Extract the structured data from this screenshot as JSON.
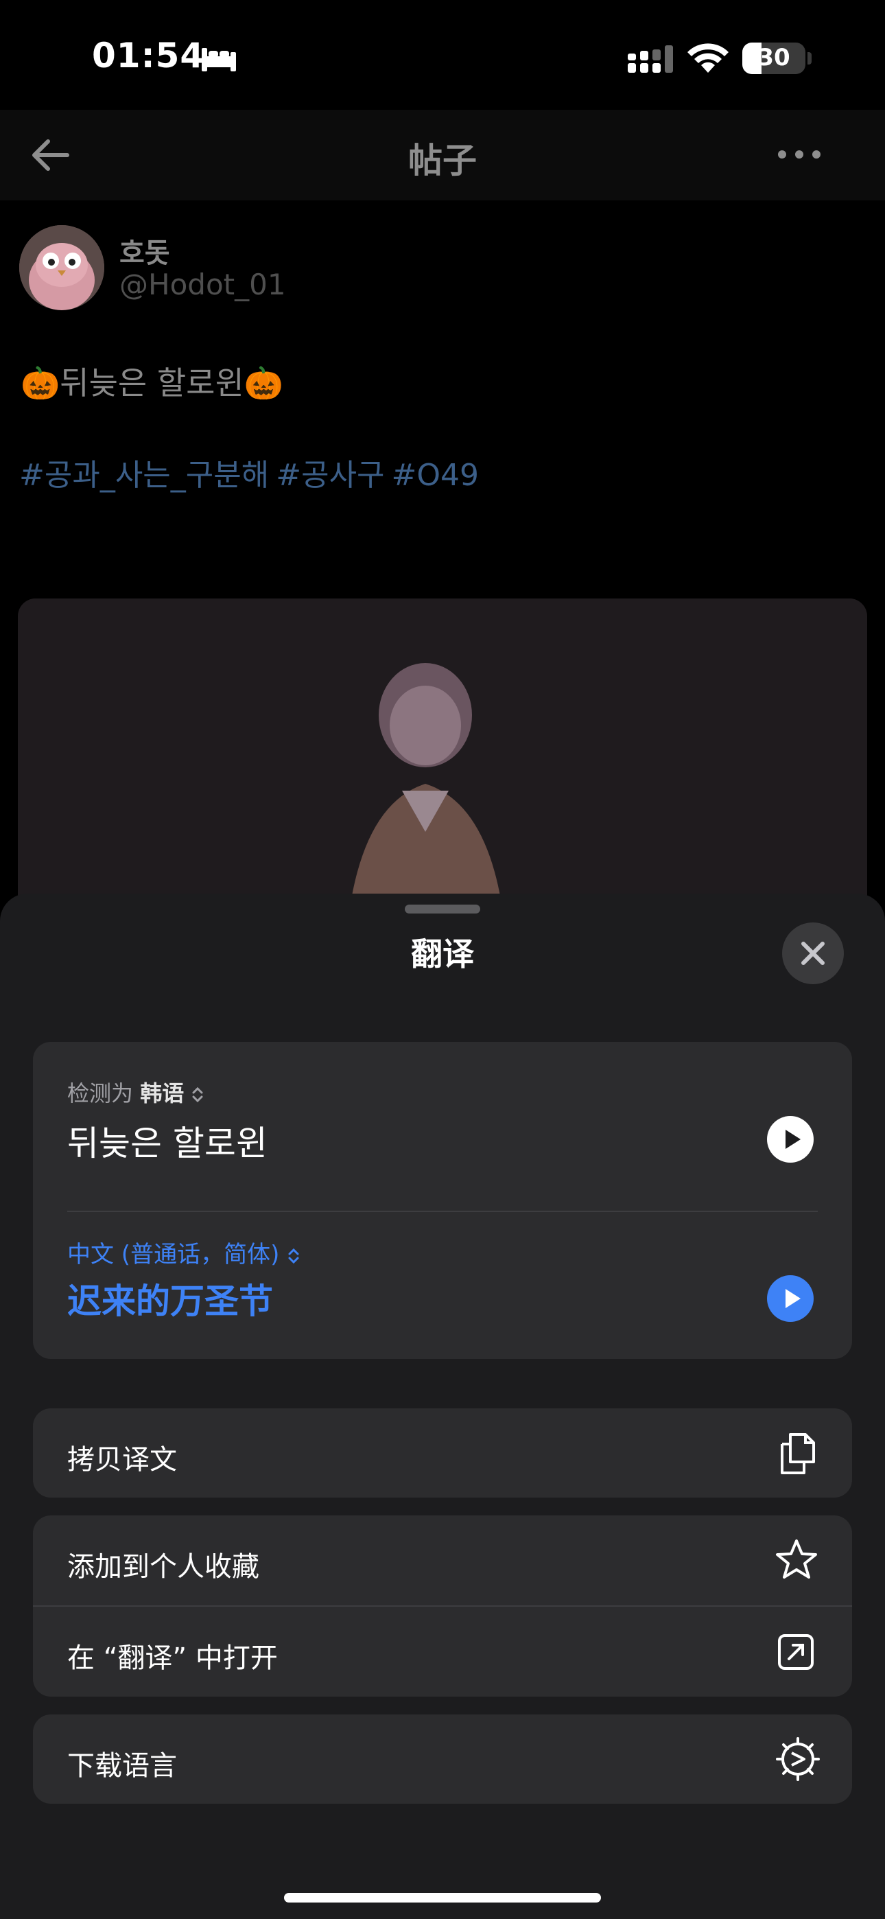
{
  "status_bar": {
    "time": "01:54",
    "battery": "30",
    "battery_level": 0.3
  },
  "nav": {
    "title": "帖子"
  },
  "post": {
    "author_name": "호돗",
    "author_handle": "@Hodot_01",
    "text": "🎃뒤늦은 할로윈🎃",
    "hashtags": [
      "#공과_사는_구분해",
      "#공사구",
      "#O49"
    ]
  },
  "sheet": {
    "title": "翻译",
    "detected_prefix": "检测为",
    "detected_language": "韩语",
    "source_text": "뒤늦은 할로윈",
    "target_language": "中文 (普通话，简体)",
    "translated_text": "迟来的万圣节",
    "actions": {
      "copy": "拷贝译文",
      "favorite": "添加到个人收藏",
      "open_in": "在 “翻译” 中打开",
      "download": "下载语言"
    }
  },
  "colors": {
    "accent": "#3e82f6",
    "sheet_bg": "#1c1c1e",
    "card_bg": "#2c2c2e",
    "hashtag": "#3c5f89"
  },
  "icons": [
    "bed-icon",
    "cellular-icon",
    "wifi-icon",
    "battery-icon",
    "back-arrow-icon",
    "more-icon",
    "close-icon",
    "play-icon",
    "copy-icon",
    "star-icon",
    "open-external-icon",
    "gear-icon"
  ]
}
